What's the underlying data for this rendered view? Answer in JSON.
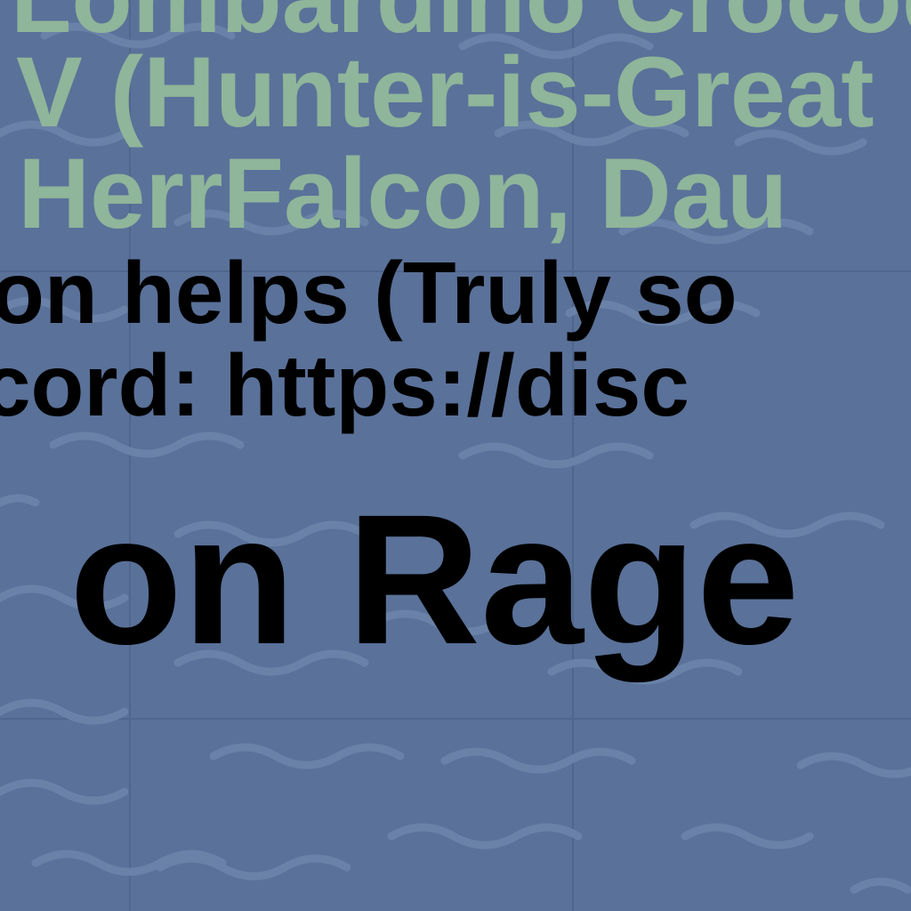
{
  "credits": {
    "line1": "Lombardino Crocodile",
    "line2": "V (Hunter-is-Great",
    "line3": ", HerrFalcon, Dau"
  },
  "info": {
    "line1": "on helps (Truly so",
    "line2": "cord: https://disc"
  },
  "title": "on Rage",
  "colors": {
    "water": "#5a7199",
    "wave": "#6a82a8",
    "grid": "#50668c",
    "credit_text": "#8fb59a",
    "info_text": "#000000"
  }
}
